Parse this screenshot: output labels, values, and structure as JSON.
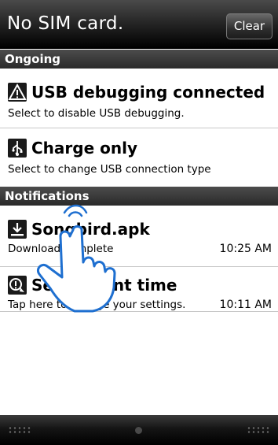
{
  "header": {
    "title": "No SIM card.",
    "clear_label": "Clear"
  },
  "sections": {
    "ongoing": "Ongoing",
    "notifications": "Notifications"
  },
  "ongoing_items": [
    {
      "icon": "warning-triangle-icon",
      "title": "USB debugging connected",
      "subtitle": "Select to disable USB debugging."
    },
    {
      "icon": "usb-icon",
      "title": "Charge only",
      "subtitle": "Select to change USB connection type"
    }
  ],
  "notification_items": [
    {
      "icon": "download-icon",
      "title": "Songbird.apk",
      "subtitle": "Download complete",
      "time": "10:25 AM"
    },
    {
      "icon": "clock-alert-icon",
      "title": "Set current time",
      "subtitle": "Tap here to change your settings.",
      "time": "10:11 AM"
    }
  ]
}
